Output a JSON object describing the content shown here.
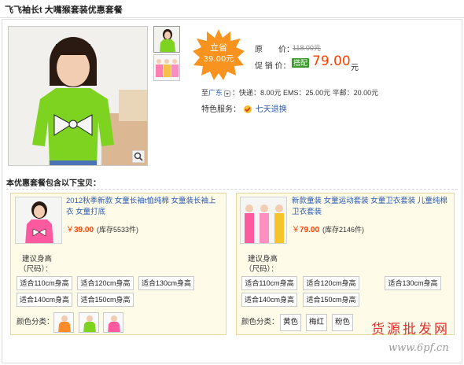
{
  "header": {
    "title": "飞飞袖长t 大嘴猴套装优惠套餐"
  },
  "product": {
    "burst_line1": "立省",
    "burst_line2": "39.00元",
    "orig_label": "原　　价：",
    "orig_price": "118.00元",
    "promo_label": "促 销 价：",
    "promo_badge": "搭配",
    "promo_price": "79.00",
    "promo_unit": "元",
    "ship_prefix": "至",
    "ship_region": "广东",
    "ship_rates": "：快递：8.00元 EMS：25.00元 平邮：20.00元",
    "feature_label": "特色服务：",
    "feature_service": "七天退换"
  },
  "package": {
    "title": "本优惠套餐包含以下宝贝：",
    "items": [
      {
        "name": "2012秋季新款 女童长袖t恤纯棉 女童装长袖上衣 女童打底",
        "currency": "￥",
        "price": "39.00",
        "stock": "(库存5533件)",
        "rec_label_1": "建议身高",
        "rec_label_2": "（尺码）：",
        "sizes": [
          "适合110cm身高",
          "适合120cm身高",
          "适合130cm身高",
          "适合140cm身高",
          "适合150cm身高"
        ],
        "color_label": "颜色分类："
      },
      {
        "name": "新款童装 女童运动套装 女童卫衣套装 儿童纯棉卫衣套装",
        "currency": "￥",
        "price": "79.00",
        "stock": "(库存2146件)",
        "rec_label_1": "建议身高",
        "rec_label_2": "（尺码）：",
        "sizes": [
          "适合110cm身高",
          "适合120cm身高",
          "适合130cm身高",
          "适合140cm身高",
          "适合150cm身高"
        ],
        "color_label": "颜色分类：",
        "colors": [
          "黄色",
          "梅红",
          "粉色"
        ]
      }
    ]
  },
  "watermark": {
    "line1": "货源批发网",
    "line2": "www.6pf.cn"
  },
  "colors": {
    "accent": "#ff4200",
    "link": "#2b5ab0",
    "promo_green": "#3a9a2a",
    "burst": "#f7931e",
    "card_bg": "#fefbe9"
  }
}
